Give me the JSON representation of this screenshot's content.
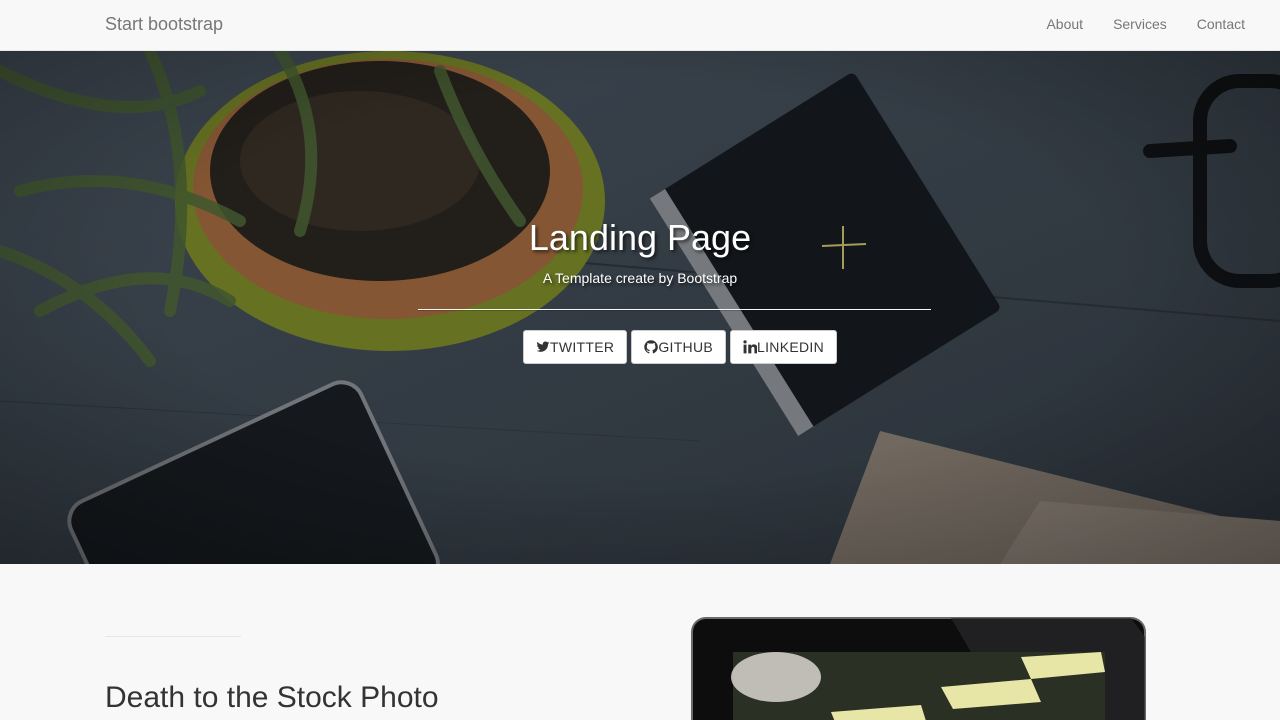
{
  "navbar": {
    "brand": "Start bootstrap",
    "links": [
      {
        "label": "About"
      },
      {
        "label": "Services"
      },
      {
        "label": "Contact"
      }
    ]
  },
  "hero": {
    "title": "Landing Page",
    "subtitle": "A Template create by Bootstrap",
    "buttons": [
      {
        "label": "TWITTER",
        "icon": "twitter-icon"
      },
      {
        "label": "GITHUB",
        "icon": "github-icon"
      },
      {
        "label": "LINKEDIN",
        "icon": "linkedin-icon"
      }
    ]
  },
  "section": {
    "heading": "Death to the Stock Photo"
  }
}
